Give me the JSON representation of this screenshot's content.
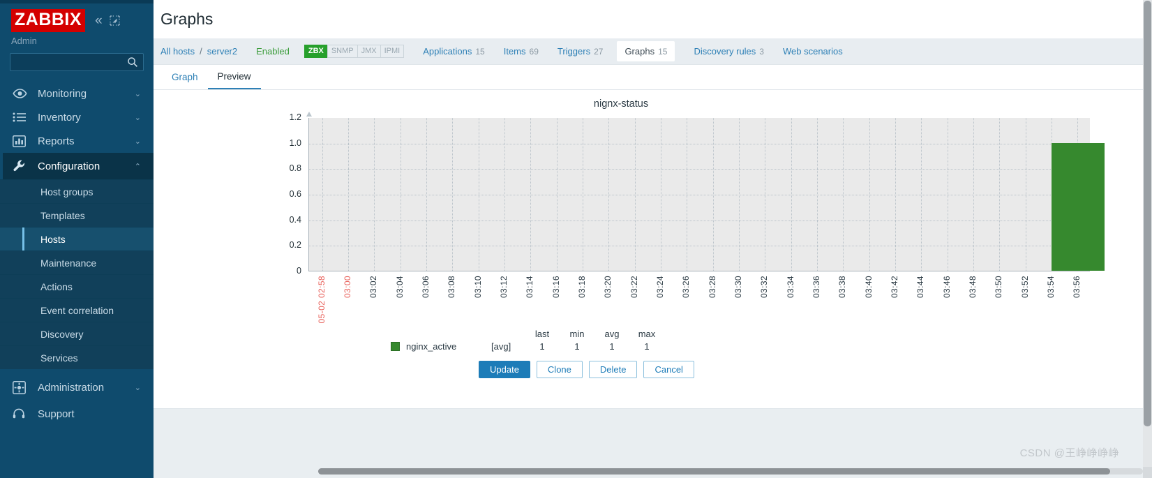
{
  "sidebar": {
    "logo": "ZABBIX",
    "collapse_icon": "«",
    "expand_icon": "expand-icon",
    "user": "Admin",
    "search_placeholder": "",
    "search_value": "",
    "items": [
      {
        "label": "Monitoring",
        "icon": "eye-icon",
        "chevron": "⌄"
      },
      {
        "label": "Inventory",
        "icon": "list-icon",
        "chevron": "⌄"
      },
      {
        "label": "Reports",
        "icon": "bar-chart-icon",
        "chevron": "⌄"
      },
      {
        "label": "Configuration",
        "icon": "wrench-icon",
        "chevron": "⌃"
      }
    ],
    "submenu": [
      {
        "label": "Host groups"
      },
      {
        "label": "Templates"
      },
      {
        "label": "Hosts"
      },
      {
        "label": "Maintenance"
      },
      {
        "label": "Actions"
      },
      {
        "label": "Event correlation"
      },
      {
        "label": "Discovery"
      },
      {
        "label": "Services"
      }
    ],
    "selected_submenu": "Hosts",
    "bottom_items": [
      {
        "label": "Administration",
        "icon": "gear-icon",
        "chevron": "⌄"
      },
      {
        "label": "Support",
        "icon": "headset-icon",
        "chevron": ""
      }
    ]
  },
  "header": {
    "title": "Graphs"
  },
  "breadcrumb": {
    "all_hosts": "All hosts",
    "separator": "/",
    "host": "server2",
    "status": "Enabled",
    "interfaces": [
      {
        "label": "ZBX",
        "active": true
      },
      {
        "label": "SNMP",
        "active": false
      },
      {
        "label": "JMX",
        "active": false
      },
      {
        "label": "IPMI",
        "active": false
      }
    ],
    "tabs": [
      {
        "label": "Applications",
        "count": "15",
        "selected": false
      },
      {
        "label": "Items",
        "count": "69",
        "selected": false
      },
      {
        "label": "Triggers",
        "count": "27",
        "selected": false
      },
      {
        "label": "Graphs",
        "count": "15",
        "selected": true
      },
      {
        "label": "Discovery rules",
        "count": "3",
        "selected": false
      },
      {
        "label": "Web scenarios",
        "count": "",
        "selected": false
      }
    ]
  },
  "subtabs": [
    {
      "label": "Graph",
      "active": false
    },
    {
      "label": "Preview",
      "active": true
    }
  ],
  "chart_data": {
    "type": "bar",
    "title": "nignx-status",
    "xlabel": "",
    "ylabel": "",
    "ylim": [
      0,
      1.2
    ],
    "yticks": [
      "1.2",
      "1.0",
      "0.8",
      "0.6",
      "0.4",
      "0.2",
      "0"
    ],
    "grid": true,
    "legend_position": "bottom",
    "xticks": [
      "05-02 02:58",
      "03:00",
      "03:02",
      "03:04",
      "03:06",
      "03:08",
      "03:10",
      "03:12",
      "03:14",
      "03:16",
      "03:18",
      "03:20",
      "03:22",
      "03:24",
      "03:26",
      "03:28",
      "03:30",
      "03:32",
      "03:34",
      "03:36",
      "03:38",
      "03:40",
      "03:42",
      "03:44",
      "03:46",
      "03:48",
      "03:50",
      "03:52",
      "03:54",
      "03:56"
    ],
    "xtick_highlight": [
      "05-02 02:58",
      "03:00"
    ],
    "series": [
      {
        "name": "nginx_active",
        "aggregation": "[avg]",
        "color": "#36892e",
        "values": [
          0,
          0,
          0,
          0,
          0,
          0,
          0,
          0,
          0,
          0,
          0,
          0,
          0,
          0,
          0,
          0,
          0,
          0,
          0,
          0,
          0,
          0,
          0,
          0,
          0,
          0,
          0,
          0,
          1,
          1
        ]
      }
    ],
    "legend_columns": [
      "last",
      "min",
      "avg",
      "max"
    ],
    "legend_rows": [
      {
        "name": "nginx_active",
        "aggregation": "[avg]",
        "last": "1",
        "min": "1",
        "avg": "1",
        "max": "1"
      }
    ]
  },
  "buttons": [
    {
      "label": "Update",
      "style": "primary"
    },
    {
      "label": "Clone",
      "style": "secondary"
    },
    {
      "label": "Delete",
      "style": "secondary"
    },
    {
      "label": "Cancel",
      "style": "secondary"
    }
  ],
  "watermark": "CSDN @王峥峥峥峥"
}
